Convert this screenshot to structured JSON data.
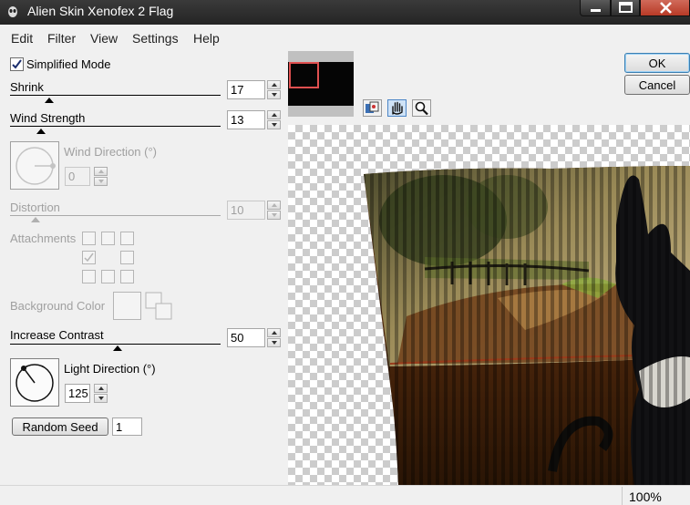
{
  "window": {
    "title": "Alien Skin Xenofex 2 Flag"
  },
  "menu": [
    "Edit",
    "Filter",
    "View",
    "Settings",
    "Help"
  ],
  "simplified_mode": {
    "label": "Simplified Mode",
    "checked": true
  },
  "shrink": {
    "label": "Shrink",
    "value": "17"
  },
  "wind_strength": {
    "label": "Wind Strength",
    "value": "13"
  },
  "wind_direction": {
    "label": "Wind Direction (°)",
    "value": "0"
  },
  "distortion": {
    "label": "Distortion",
    "value": "10"
  },
  "attachments": {
    "label": "Attachments"
  },
  "background_color": {
    "label": "Background Color"
  },
  "increase_contrast": {
    "label": "Increase Contrast",
    "value": "50"
  },
  "light_direction": {
    "label": "Light Direction (°)",
    "value": "125"
  },
  "random_seed": {
    "label": "Random Seed",
    "value": "1"
  },
  "buttons": {
    "ok": "OK",
    "cancel": "Cancel"
  },
  "status": {
    "zoom": "100%"
  },
  "colors": {
    "titlebar": "#2e2e2e",
    "close_button": "#c44a36",
    "thumb_selection": "#e05050"
  }
}
